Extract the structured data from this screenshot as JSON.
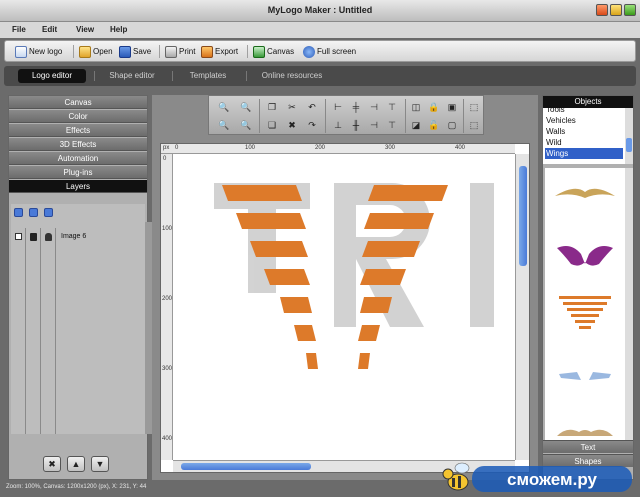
{
  "window": {
    "title": "MyLogo Maker : Untitled"
  },
  "menu": [
    "File",
    "Edit",
    "View",
    "Help"
  ],
  "toolbar": {
    "new_logo": "New logo",
    "open": "Open",
    "save": "Save",
    "print": "Print",
    "export": "Export",
    "canvas": "Canvas",
    "full_screen": "Full screen"
  },
  "tabs": [
    "Logo editor",
    "Shape editor",
    "Templates",
    "Online resources"
  ],
  "left_panel": {
    "items": [
      "Canvas",
      "Color",
      "Effects",
      "3D Effects",
      "Automation",
      "Plug-ins",
      "Layers"
    ],
    "layers": [
      {
        "name": "Image 6"
      }
    ]
  },
  "ruler": {
    "top": [
      "px",
      "0",
      "100",
      "200",
      "300",
      "400"
    ],
    "left": [
      "0",
      "100",
      "200",
      "300",
      "400"
    ]
  },
  "right_panel": {
    "header": "Objects",
    "list": [
      "Tools",
      "Vehicles",
      "Walls",
      "Wild",
      "Wings"
    ],
    "selected": "Wings",
    "tabs": [
      "Text",
      "Shapes"
    ]
  },
  "status": "Zoom: 100%, Canvas: 1200x1200 (px), X: 231, Y: 44",
  "watermark": "сможем.ру",
  "colors": {
    "accent": "#dd7a2a",
    "selection": "#3060c8"
  }
}
